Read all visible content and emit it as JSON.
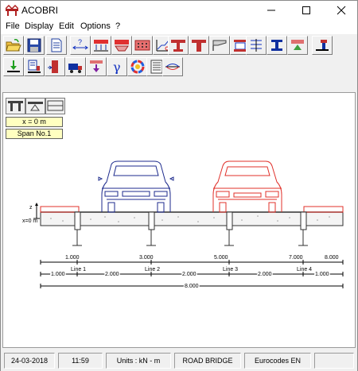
{
  "window": {
    "title": "ACOBRI"
  },
  "menu": {
    "file": "File",
    "display": "Display",
    "edit": "Edit",
    "options": "Options",
    "help": "?"
  },
  "toolbar": {
    "row1": [
      "open-icon",
      "save-icon",
      "document-icon",
      "help-arrows-icon",
      "truck-load-icon",
      "slab-icon",
      "distributed-load-icon",
      "section-icon",
      "beam-section-icon",
      "cantilever-icon",
      "deck-icon",
      "stack-icon",
      "i-beam-icon",
      "support-icon",
      "pier-icon"
    ],
    "row2": [
      "download-icon",
      "report-icon",
      "pier-load-icon",
      "truck-icon",
      "filter-icon",
      "gamma-icon",
      "color-wheel-icon",
      "list-icon",
      "deflection-icon"
    ]
  },
  "view": {
    "position": "x = 0 m",
    "span": "Span No.1"
  },
  "drawing": {
    "z_axis": "z",
    "origin": "x=0 m",
    "chainage": [
      "1.000",
      "3.000",
      "5.000",
      "7.000",
      "8.000"
    ],
    "spans": [
      "1.000",
      "2.000",
      "2.000",
      "2.000",
      "1.000"
    ],
    "lines": [
      "Line 1",
      "Line 2",
      "Line 3",
      "Line 4"
    ],
    "total": "8.000",
    "colors": {
      "car_left": "#1c2a8c",
      "car_right": "#e0302a",
      "curb": "#e0302a"
    }
  },
  "status": {
    "date": "24-03-2018",
    "time": "11:59",
    "units": "Units : kN - m",
    "type": "ROAD BRIDGE",
    "code": "Eurocodes EN"
  }
}
